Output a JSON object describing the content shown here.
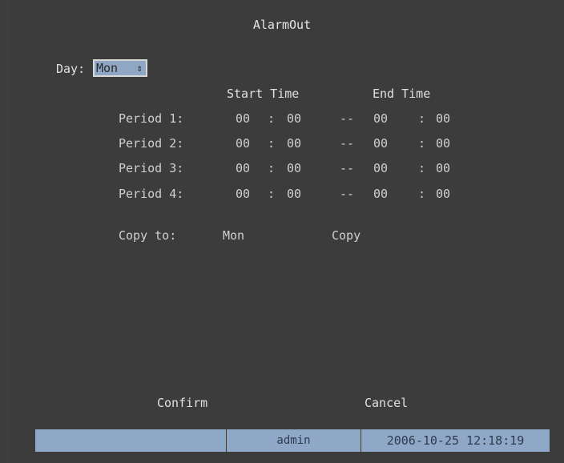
{
  "title": "AlarmOut",
  "day": {
    "label": "Day:",
    "value": "Mon",
    "arrows": "⇕"
  },
  "headers": {
    "start": "Start Time",
    "end": "End Time"
  },
  "periods": [
    {
      "label": "Period 1:",
      "sh": "00",
      "sm": "00",
      "eh": "00",
      "em": "00"
    },
    {
      "label": "Period 2:",
      "sh": "00",
      "sm": "00",
      "eh": "00",
      "em": "00"
    },
    {
      "label": "Period 3:",
      "sh": "00",
      "sm": "00",
      "eh": "00",
      "em": "00"
    },
    {
      "label": "Period 4:",
      "sh": "00",
      "sm": "00",
      "eh": "00",
      "em": "00"
    }
  ],
  "separators": {
    "colon": ":",
    "dash": "--"
  },
  "copy": {
    "label": "Copy to:",
    "day": "Mon",
    "button": "Copy"
  },
  "buttons": {
    "confirm": "Confirm",
    "cancel": "Cancel"
  },
  "status": {
    "user": "admin",
    "datetime": "2006-10-25 12:18:19"
  },
  "colors": {
    "background": "#3c3c3c",
    "accent": "#8fa8c8"
  }
}
